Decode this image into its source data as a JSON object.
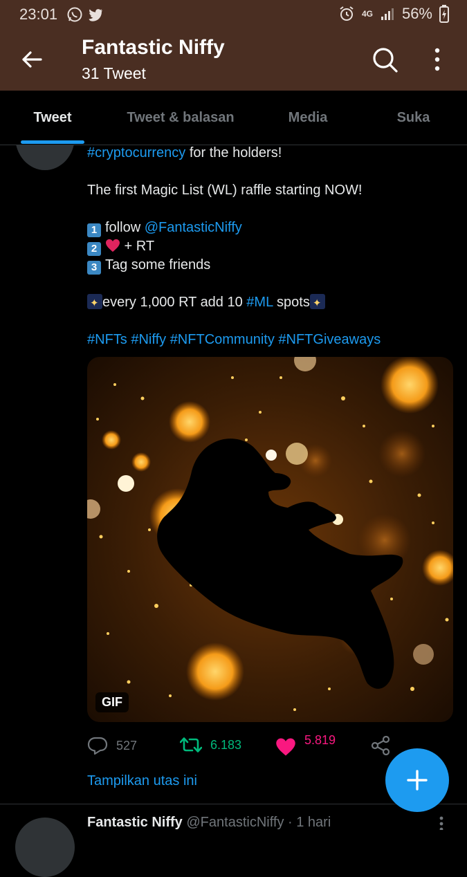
{
  "status_bar": {
    "time": "23:01",
    "network": "4G",
    "battery": "56%",
    "left_icons": [
      "whatsapp-icon",
      "twitter-icon"
    ],
    "right_icons": [
      "alarm-icon",
      "signal-icon",
      "battery-charging-icon"
    ]
  },
  "header": {
    "title": "Fantastic Niffy",
    "subtitle": "31 Tweet",
    "background": "#4a2e22"
  },
  "tabs": [
    {
      "label": "Tweet",
      "active": true
    },
    {
      "label": "Tweet & balasan",
      "active": false
    },
    {
      "label": "Media",
      "active": false
    },
    {
      "label": "Suka",
      "active": false
    }
  ],
  "tweet": {
    "hashtag_crypto": "#cryptocurrency",
    "line1_rest": " for the holders!",
    "line2": "The first Magic List (WL) raffle starting NOW!",
    "step1_num": "1",
    "step1_text": "follow ",
    "step1_mention": "@FantasticNiffy",
    "step2_num": "2",
    "step2_text": " + RT",
    "step3_num": "3",
    "step3_text": "Tag some friends",
    "spots_pre": "every 1,000 RT add 10 ",
    "spots_tag": "#ML",
    "spots_post": " spots",
    "hashtags": [
      "#NFTs",
      "#Niffy",
      "#NFTCommunity",
      "#NFTGiveaways"
    ],
    "media_badge": "GIF",
    "replies": "527",
    "retweets": "6.183",
    "likes": "5.819",
    "show_thread": "Tampilkan utas ini"
  },
  "next_tweet": {
    "name": "Fantastic Niffy",
    "handle": "@FantasticNiffy",
    "time": " · 1 hari"
  },
  "colors": {
    "accent": "#1d9bf0",
    "retweet": "#00ba7c",
    "like": "#f91880"
  }
}
